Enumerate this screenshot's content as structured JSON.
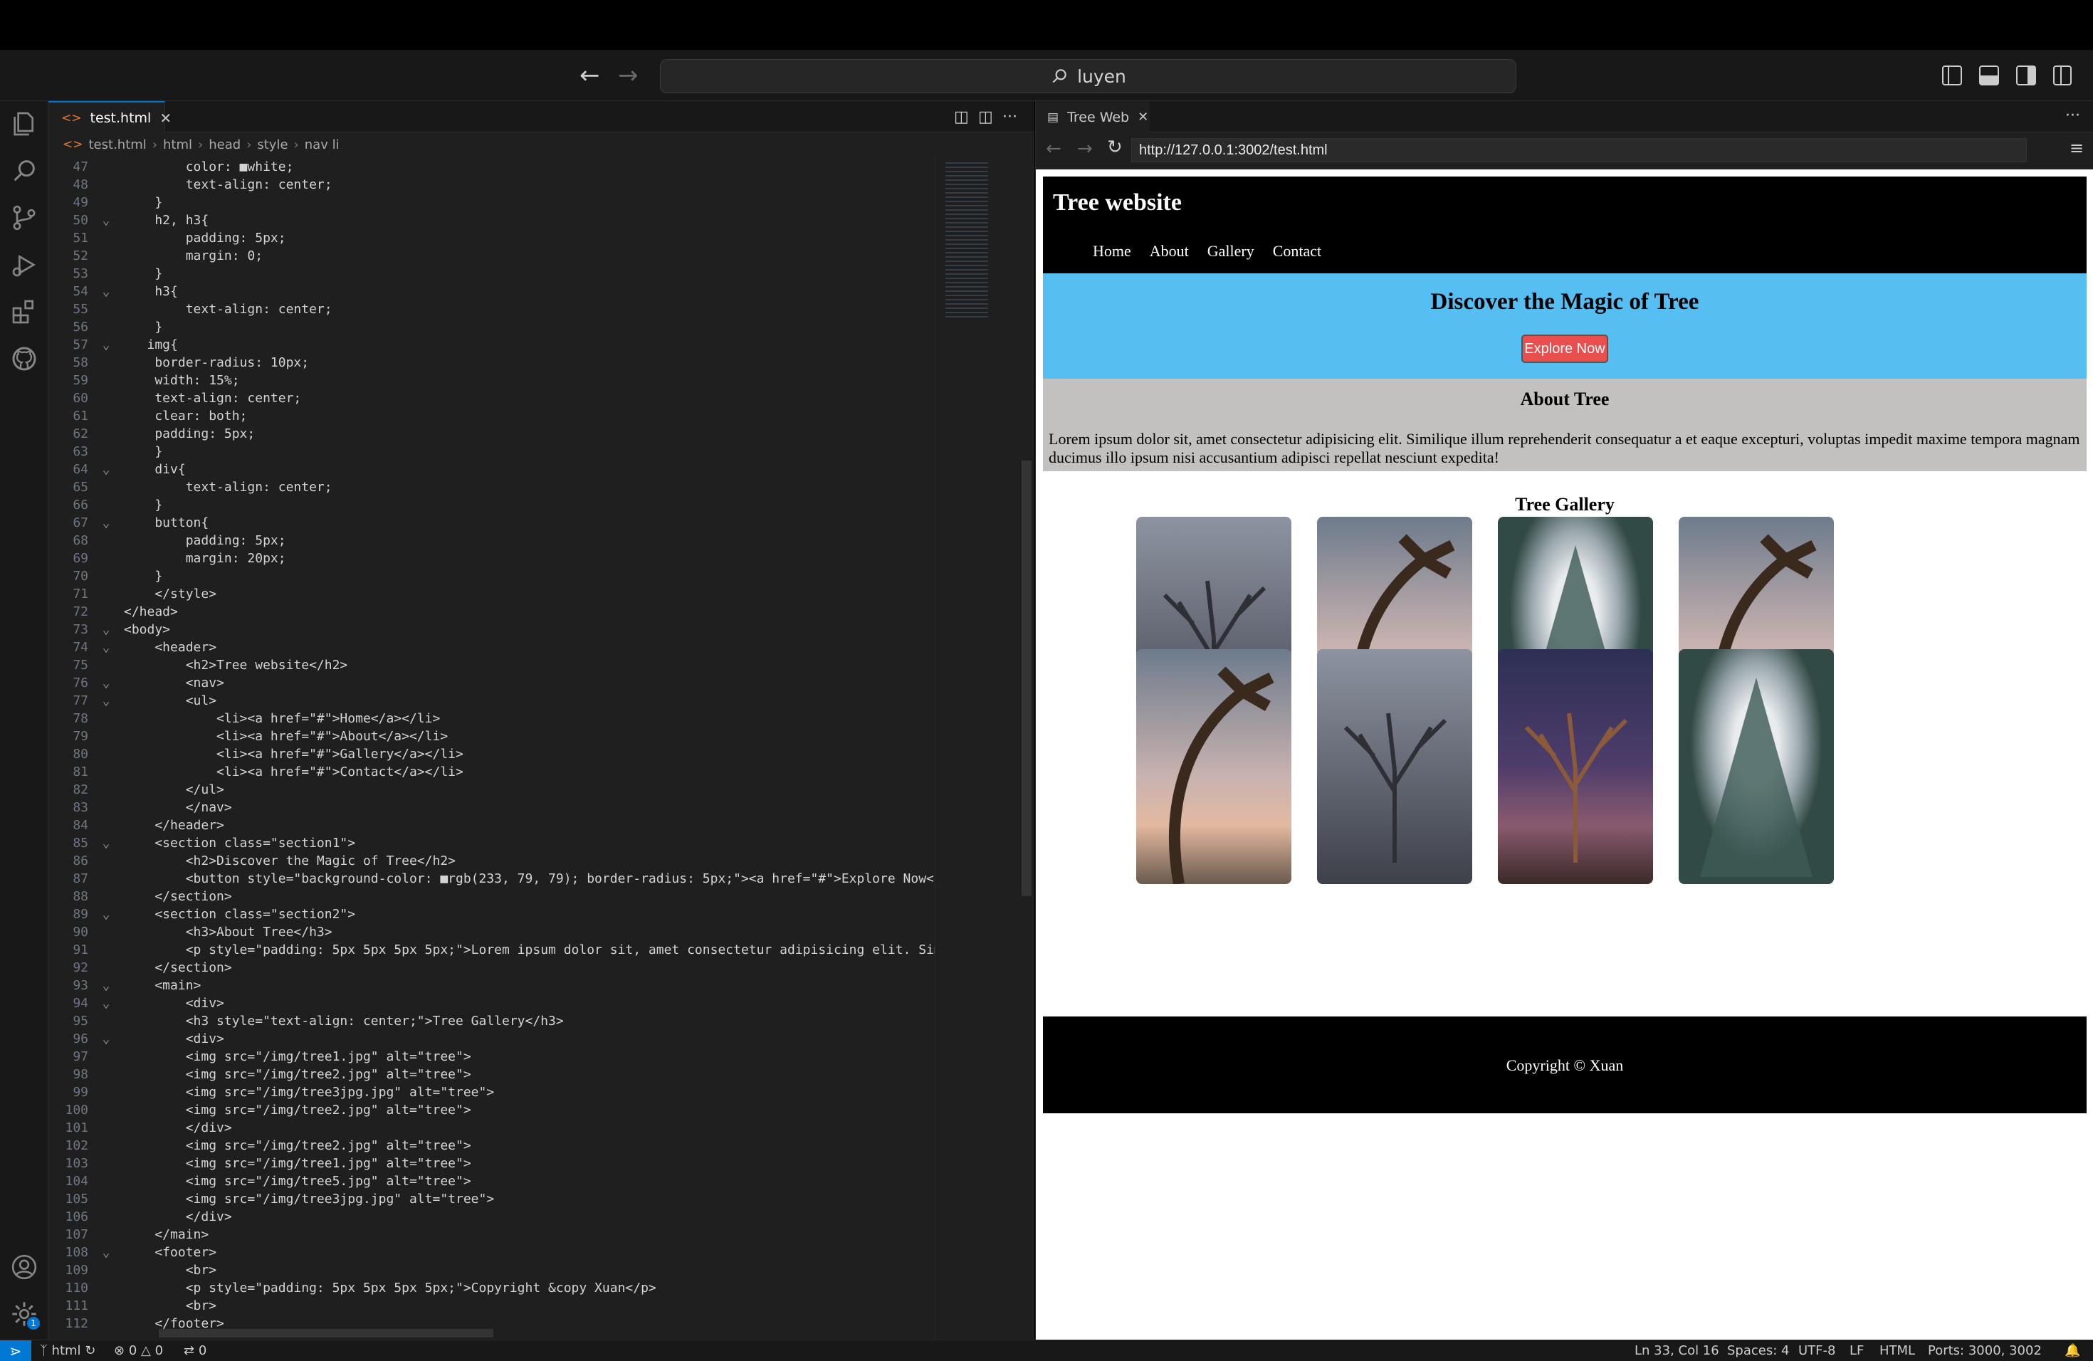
{
  "titlebar": {
    "search_text": "luyen"
  },
  "editor": {
    "tab_label": "test.html",
    "breadcrumb": [
      "test.html",
      "html",
      "head",
      "style",
      "nav li"
    ],
    "code_lines": [
      {
        "n": "47",
        "fold": "",
        "text": "        color: ■white;"
      },
      {
        "n": "48",
        "fold": "",
        "text": "        text-align: center;"
      },
      {
        "n": "49",
        "fold": "",
        "text": "    }"
      },
      {
        "n": "50",
        "fold": "⌄",
        "text": "    h2, h3{"
      },
      {
        "n": "51",
        "fold": "",
        "text": "        padding: 5px;"
      },
      {
        "n": "52",
        "fold": "",
        "text": "        margin: 0;"
      },
      {
        "n": "53",
        "fold": "",
        "text": "    }"
      },
      {
        "n": "54",
        "fold": "⌄",
        "text": "    h3{"
      },
      {
        "n": "55",
        "fold": "",
        "text": "        text-align: center;"
      },
      {
        "n": "56",
        "fold": "",
        "text": "    }"
      },
      {
        "n": "57",
        "fold": "⌄",
        "text": "   img{"
      },
      {
        "n": "58",
        "fold": "",
        "text": "    border-radius: 10px;"
      },
      {
        "n": "59",
        "fold": "",
        "text": "    width: 15%;"
      },
      {
        "n": "60",
        "fold": "",
        "text": "    text-align: center;"
      },
      {
        "n": "61",
        "fold": "",
        "text": "    clear: both;"
      },
      {
        "n": "62",
        "fold": "",
        "text": "    padding: 5px;"
      },
      {
        "n": "63",
        "fold": "",
        "text": "    }"
      },
      {
        "n": "64",
        "fold": "⌄",
        "text": "    div{"
      },
      {
        "n": "65",
        "fold": "",
        "text": "        text-align: center;"
      },
      {
        "n": "66",
        "fold": "",
        "text": "    }"
      },
      {
        "n": "67",
        "fold": "⌄",
        "text": "    button{"
      },
      {
        "n": "68",
        "fold": "",
        "text": "        padding: 5px;"
      },
      {
        "n": "69",
        "fold": "",
        "text": "        margin: 20px;"
      },
      {
        "n": "70",
        "fold": "",
        "text": "    }"
      },
      {
        "n": "71",
        "fold": "",
        "text": "    </style>"
      },
      {
        "n": "72",
        "fold": "",
        "text": "</head>"
      },
      {
        "n": "73",
        "fold": "⌄",
        "text": "<body>"
      },
      {
        "n": "74",
        "fold": "⌄",
        "text": "    <header>"
      },
      {
        "n": "75",
        "fold": "",
        "text": "        <h2>Tree website</h2>"
      },
      {
        "n": "76",
        "fold": "⌄",
        "text": "        <nav>"
      },
      {
        "n": "77",
        "fold": "⌄",
        "text": "        <ul>"
      },
      {
        "n": "78",
        "fold": "",
        "text": "            <li><a href=\"#\">Home</a></li>"
      },
      {
        "n": "79",
        "fold": "",
        "text": "            <li><a href=\"#\">About</a></li>"
      },
      {
        "n": "80",
        "fold": "",
        "text": "            <li><a href=\"#\">Gallery</a></li>"
      },
      {
        "n": "81",
        "fold": "",
        "text": "            <li><a href=\"#\">Contact</a></li>"
      },
      {
        "n": "82",
        "fold": "",
        "text": "        </ul>"
      },
      {
        "n": "83",
        "fold": "",
        "text": "        </nav>"
      },
      {
        "n": "84",
        "fold": "",
        "text": "    </header>"
      },
      {
        "n": "85",
        "fold": "⌄",
        "text": "    <section class=\"section1\">"
      },
      {
        "n": "86",
        "fold": "",
        "text": "        <h2>Discover the Magic of Tree</h2>"
      },
      {
        "n": "87",
        "fold": "",
        "text": "        <button style=\"background-color: ■rgb(233, 79, 79); border-radius: 5px;\"><a href=\"#\">Explore Now</a></butt"
      },
      {
        "n": "88",
        "fold": "",
        "text": "    </section>"
      },
      {
        "n": "89",
        "fold": "⌄",
        "text": "    <section class=\"section2\">"
      },
      {
        "n": "90",
        "fold": "",
        "text": "        <h3>About Tree</h3>"
      },
      {
        "n": "91",
        "fold": "",
        "text": "        <p style=\"padding: 5px 5px 5px 5px;\">Lorem ipsum dolor sit, amet consectetur adipisicing elit. Similique il"
      },
      {
        "n": "92",
        "fold": "",
        "text": "    </section>"
      },
      {
        "n": "93",
        "fold": "⌄",
        "text": "    <main>"
      },
      {
        "n": "94",
        "fold": "⌄",
        "text": "        <div>"
      },
      {
        "n": "95",
        "fold": "",
        "text": "        <h3 style=\"text-align: center;\">Tree Gallery</h3>"
      },
      {
        "n": "96",
        "fold": "⌄",
        "text": "        <div>"
      },
      {
        "n": "97",
        "fold": "",
        "text": "        <img src=\"/img/tree1.jpg\" alt=\"tree\">"
      },
      {
        "n": "98",
        "fold": "",
        "text": "        <img src=\"/img/tree2.jpg\" alt=\"tree\">"
      },
      {
        "n": "99",
        "fold": "",
        "text": "        <img src=\"/img/tree3jpg.jpg\" alt=\"tree\">"
      },
      {
        "n": "100",
        "fold": "",
        "text": "        <img src=\"/img/tree2.jpg\" alt=\"tree\">"
      },
      {
        "n": "101",
        "fold": "",
        "text": "        </div>"
      },
      {
        "n": "102",
        "fold": "",
        "text": "        <img src=\"/img/tree2.jpg\" alt=\"tree\">"
      },
      {
        "n": "103",
        "fold": "",
        "text": "        <img src=\"/img/tree1.jpg\" alt=\"tree\">"
      },
      {
        "n": "104",
        "fold": "",
        "text": "        <img src=\"/img/tree5.jpg\" alt=\"tree\">"
      },
      {
        "n": "105",
        "fold": "",
        "text": "        <img src=\"/img/tree3jpg.jpg\" alt=\"tree\">"
      },
      {
        "n": "106",
        "fold": "",
        "text": "        </div>"
      },
      {
        "n": "107",
        "fold": "",
        "text": "    </main>"
      },
      {
        "n": "108",
        "fold": "⌄",
        "text": "    <footer>"
      },
      {
        "n": "109",
        "fold": "",
        "text": "        <br>"
      },
      {
        "n": "110",
        "fold": "",
        "text": "        <p style=\"padding: 5px 5px 5px 5px;\">Copyright &copy Xuan</p>"
      },
      {
        "n": "111",
        "fold": "",
        "text": "        <br>"
      },
      {
        "n": "112",
        "fold": "",
        "text": "    </footer>"
      }
    ]
  },
  "preview": {
    "tab_label": "Tree Web",
    "url": "http://127.0.0.1:3002/test.html",
    "site": {
      "title": "Tree website",
      "nav": [
        "Home",
        "About",
        "Gallery",
        "Contact"
      ],
      "section1_title": "Discover the Magic of Tree",
      "button_label": "Explore Now",
      "section2_title": "About Tree",
      "section2_text": "Lorem ipsum dolor sit, amet consectetur adipisicing elit. Similique illum reprehenderit consequatur a et eaque excepturi, voluptas impedit maxime tempora magnam ducimus illo ipsum nisi accusantium adipisci repellat nesciunt expedita!",
      "gallery_title": "Tree Gallery",
      "gallery_images": [
        {
          "kind": "foggy-tree"
        },
        {
          "kind": "palm-swing"
        },
        {
          "kind": "pine-tree"
        },
        {
          "kind": "palm-swing"
        },
        {
          "kind": "palm-swing"
        },
        {
          "kind": "foggy-tree"
        },
        {
          "kind": "night-tree"
        },
        {
          "kind": "pine-tree"
        }
      ],
      "footer_text": "Copyright © Xuan"
    }
  },
  "statusbar": {
    "branch": "html",
    "errors": "0",
    "warnings": "0",
    "ports_count": "0",
    "cursor": "Ln 33, Col 16",
    "spaces": "Spaces: 4",
    "encoding": "UTF-8",
    "eol": "LF",
    "language": "HTML",
    "ports": "Ports: 3000, 3002"
  },
  "accounts_badge": "1",
  "colors": {
    "accent": "#0078d4",
    "section1_bg": "#56bef0",
    "section2_bg": "#c2c1bf",
    "button_bg": "#e94f4f"
  }
}
